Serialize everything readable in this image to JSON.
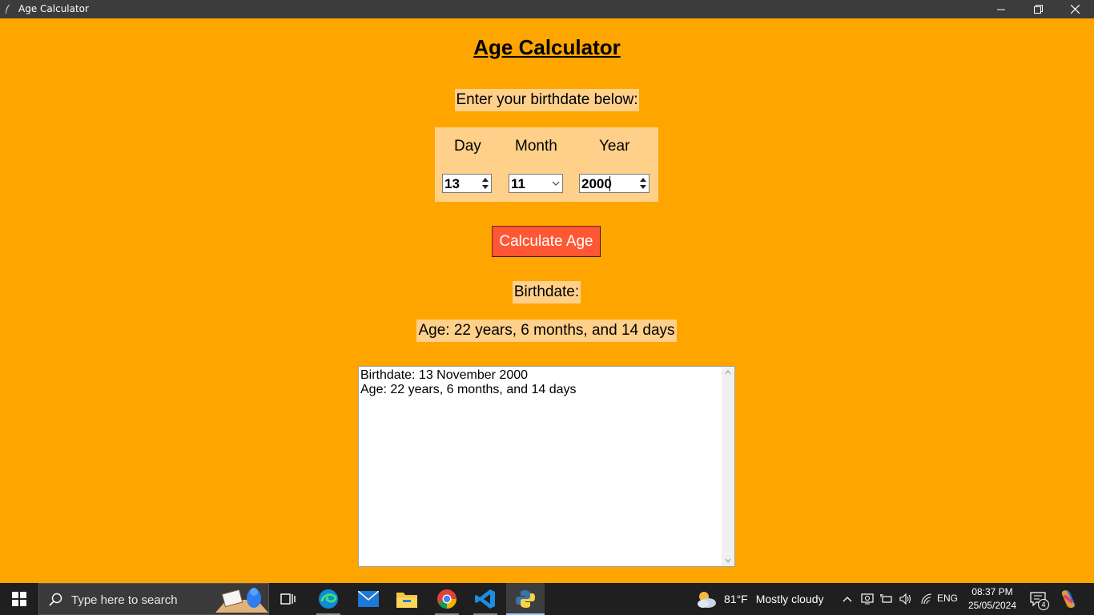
{
  "window": {
    "title": "Age Calculator",
    "controls": [
      "minimize-icon",
      "restore-icon",
      "close-icon"
    ]
  },
  "app": {
    "heading": "Age Calculator",
    "prompt": "Enter your birthdate below:",
    "fields": {
      "day_label": "Day",
      "month_label": "Month",
      "year_label": "Year",
      "day_value": "13",
      "month_value": "11",
      "year_value": "2000"
    },
    "calculate_button": "Calculate Age",
    "birthdate_label": "Birthdate:",
    "age_label": "Age: 22 years, 6 months, and 14 days",
    "output": {
      "line1": "Birthdate: 13 November 2000",
      "line2": "Age: 22 years, 6 months, and 14 days"
    }
  },
  "colors": {
    "background": "#ffa500",
    "label_bg": "#ffd08a",
    "button": "#ff5733"
  },
  "taskbar": {
    "search_placeholder": "Type here to search",
    "pinned": [
      "task-view-icon",
      "edge-icon",
      "mail-icon",
      "file-explorer-icon",
      "chrome-icon",
      "vscode-icon",
      "python-icon"
    ],
    "weather": {
      "temperature": "81°F",
      "condition": "Mostly cloudy"
    },
    "language": "ENG",
    "time": "08:37 PM",
    "date": "25/05/2024",
    "notification_count": "4"
  }
}
